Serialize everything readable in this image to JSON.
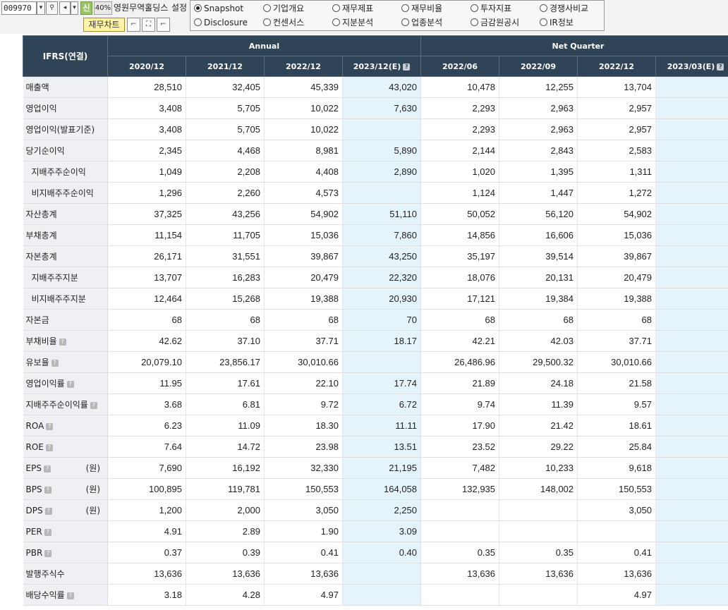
{
  "toolbar": {
    "stock_code": "009970",
    "zoom": "40%",
    "stock_name": "영원무역홀딩스",
    "settings_label": "설정",
    "chart_button": "재무차트",
    "new_badge": "신",
    "radio_options": [
      {
        "label": "Snapshot",
        "selected": true
      },
      {
        "label": "기업개요",
        "selected": false
      },
      {
        "label": "재무제표",
        "selected": false
      },
      {
        "label": "재무비율",
        "selected": false
      },
      {
        "label": "투자지표",
        "selected": false
      },
      {
        "label": "경쟁사비교",
        "selected": false
      },
      {
        "label": "Disclosure",
        "selected": false
      },
      {
        "label": "컨센서스",
        "selected": false
      },
      {
        "label": "지분분석",
        "selected": false
      },
      {
        "label": "업종분석",
        "selected": false
      },
      {
        "label": "금감원공시",
        "selected": false
      },
      {
        "label": "IR정보",
        "selected": false
      }
    ]
  },
  "table": {
    "corner": "IFRS(연결)",
    "group_annual": "Annual",
    "group_quarter": "Net Quarter",
    "columns": [
      "2020/12",
      "2021/12",
      "2022/12",
      "2023/12(E)",
      "2022/06",
      "2022/09",
      "2022/12",
      "2023/03(E)"
    ],
    "estimate_columns": [
      3,
      7
    ],
    "rows": [
      {
        "label": "매출액",
        "indent": false,
        "help": false,
        "unit": "",
        "values": [
          "28,510",
          "32,405",
          "45,339",
          "43,020",
          "10,478",
          "12,255",
          "13,704",
          ""
        ]
      },
      {
        "label": "영업이익",
        "indent": false,
        "help": false,
        "unit": "",
        "values": [
          "3,408",
          "5,705",
          "10,022",
          "7,630",
          "2,293",
          "2,963",
          "2,957",
          ""
        ]
      },
      {
        "label": "영업이익(발표기준)",
        "indent": false,
        "help": false,
        "unit": "",
        "values": [
          "3,408",
          "5,705",
          "10,022",
          "",
          "2,293",
          "2,963",
          "2,957",
          ""
        ]
      },
      {
        "label": "당기순이익",
        "indent": false,
        "help": false,
        "unit": "",
        "values": [
          "2,345",
          "4,468",
          "8,981",
          "5,890",
          "2,144",
          "2,843",
          "2,583",
          ""
        ]
      },
      {
        "label": "지배주주순이익",
        "indent": true,
        "help": false,
        "unit": "",
        "values": [
          "1,049",
          "2,208",
          "4,408",
          "2,890",
          "1,020",
          "1,395",
          "1,311",
          ""
        ]
      },
      {
        "label": "비지배주주순이익",
        "indent": true,
        "help": false,
        "unit": "",
        "values": [
          "1,296",
          "2,260",
          "4,573",
          "",
          "1,124",
          "1,447",
          "1,272",
          ""
        ]
      },
      {
        "label": "자산총계",
        "indent": false,
        "help": false,
        "unit": "",
        "values": [
          "37,325",
          "43,256",
          "54,902",
          "51,110",
          "50,052",
          "56,120",
          "54,902",
          ""
        ]
      },
      {
        "label": "부채총계",
        "indent": false,
        "help": false,
        "unit": "",
        "values": [
          "11,154",
          "11,705",
          "15,036",
          "7,860",
          "14,856",
          "16,606",
          "15,036",
          ""
        ]
      },
      {
        "label": "자본총계",
        "indent": false,
        "help": false,
        "unit": "",
        "values": [
          "26,171",
          "31,551",
          "39,867",
          "43,250",
          "35,197",
          "39,514",
          "39,867",
          ""
        ]
      },
      {
        "label": "지배주주지분",
        "indent": true,
        "help": false,
        "unit": "",
        "values": [
          "13,707",
          "16,283",
          "20,479",
          "22,320",
          "18,076",
          "20,131",
          "20,479",
          ""
        ]
      },
      {
        "label": "비지배주주지분",
        "indent": true,
        "help": false,
        "unit": "",
        "values": [
          "12,464",
          "15,268",
          "19,388",
          "20,930",
          "17,121",
          "19,384",
          "19,388",
          ""
        ]
      },
      {
        "label": "자본금",
        "indent": false,
        "help": false,
        "unit": "",
        "values": [
          "68",
          "68",
          "68",
          "70",
          "68",
          "68",
          "68",
          ""
        ]
      },
      {
        "label": "부채비율",
        "indent": false,
        "help": true,
        "unit": "",
        "values": [
          "42.62",
          "37.10",
          "37.71",
          "18.17",
          "42.21",
          "42.03",
          "37.71",
          ""
        ]
      },
      {
        "label": "유보율",
        "indent": false,
        "help": true,
        "unit": "",
        "values": [
          "20,079.10",
          "23,856.17",
          "30,010.66",
          "",
          "26,486.96",
          "29,500.32",
          "30,010.66",
          ""
        ]
      },
      {
        "label": "영업이익률",
        "indent": false,
        "help": true,
        "unit": "",
        "values": [
          "11.95",
          "17.61",
          "22.10",
          "17.74",
          "21.89",
          "24.18",
          "21.58",
          ""
        ]
      },
      {
        "label": "지배주주순이익률",
        "indent": false,
        "help": true,
        "unit": "",
        "values": [
          "3.68",
          "6.81",
          "9.72",
          "6.72",
          "9.74",
          "11.39",
          "9.57",
          ""
        ]
      },
      {
        "label": "ROA",
        "indent": false,
        "help": true,
        "unit": "",
        "values": [
          "6.23",
          "11.09",
          "18.30",
          "11.11",
          "17.90",
          "21.42",
          "18.61",
          ""
        ]
      },
      {
        "label": "ROE",
        "indent": false,
        "help": true,
        "unit": "",
        "values": [
          "7.64",
          "14.72",
          "23.98",
          "13.51",
          "23.52",
          "29.22",
          "25.84",
          ""
        ]
      },
      {
        "label": "EPS",
        "indent": false,
        "help": true,
        "unit": "(원)",
        "values": [
          "7,690",
          "16,192",
          "32,330",
          "21,195",
          "7,482",
          "10,233",
          "9,618",
          ""
        ]
      },
      {
        "label": "BPS",
        "indent": false,
        "help": true,
        "unit": "(원)",
        "values": [
          "100,895",
          "119,781",
          "150,553",
          "164,058",
          "132,935",
          "148,002",
          "150,553",
          ""
        ]
      },
      {
        "label": "DPS",
        "indent": false,
        "help": true,
        "unit": "(원)",
        "values": [
          "1,200",
          "2,000",
          "3,050",
          "2,250",
          "",
          "",
          "3,050",
          ""
        ]
      },
      {
        "label": "PER",
        "indent": false,
        "help": true,
        "unit": "",
        "values": [
          "4.91",
          "2.89",
          "1.90",
          "3.09",
          "",
          "",
          "",
          ""
        ]
      },
      {
        "label": "PBR",
        "indent": false,
        "help": true,
        "unit": "",
        "values": [
          "0.37",
          "0.39",
          "0.41",
          "0.40",
          "0.35",
          "0.35",
          "0.41",
          ""
        ]
      },
      {
        "label": "발행주식수",
        "indent": false,
        "help": false,
        "unit": "",
        "values": [
          "13,636",
          "13,636",
          "13,636",
          "",
          "13,636",
          "13,636",
          "13,636",
          ""
        ]
      },
      {
        "label": "배당수익률",
        "indent": false,
        "help": true,
        "unit": "",
        "values": [
          "3.18",
          "4.28",
          "4.97",
          "",
          "",
          "",
          "4.97",
          ""
        ]
      }
    ]
  }
}
